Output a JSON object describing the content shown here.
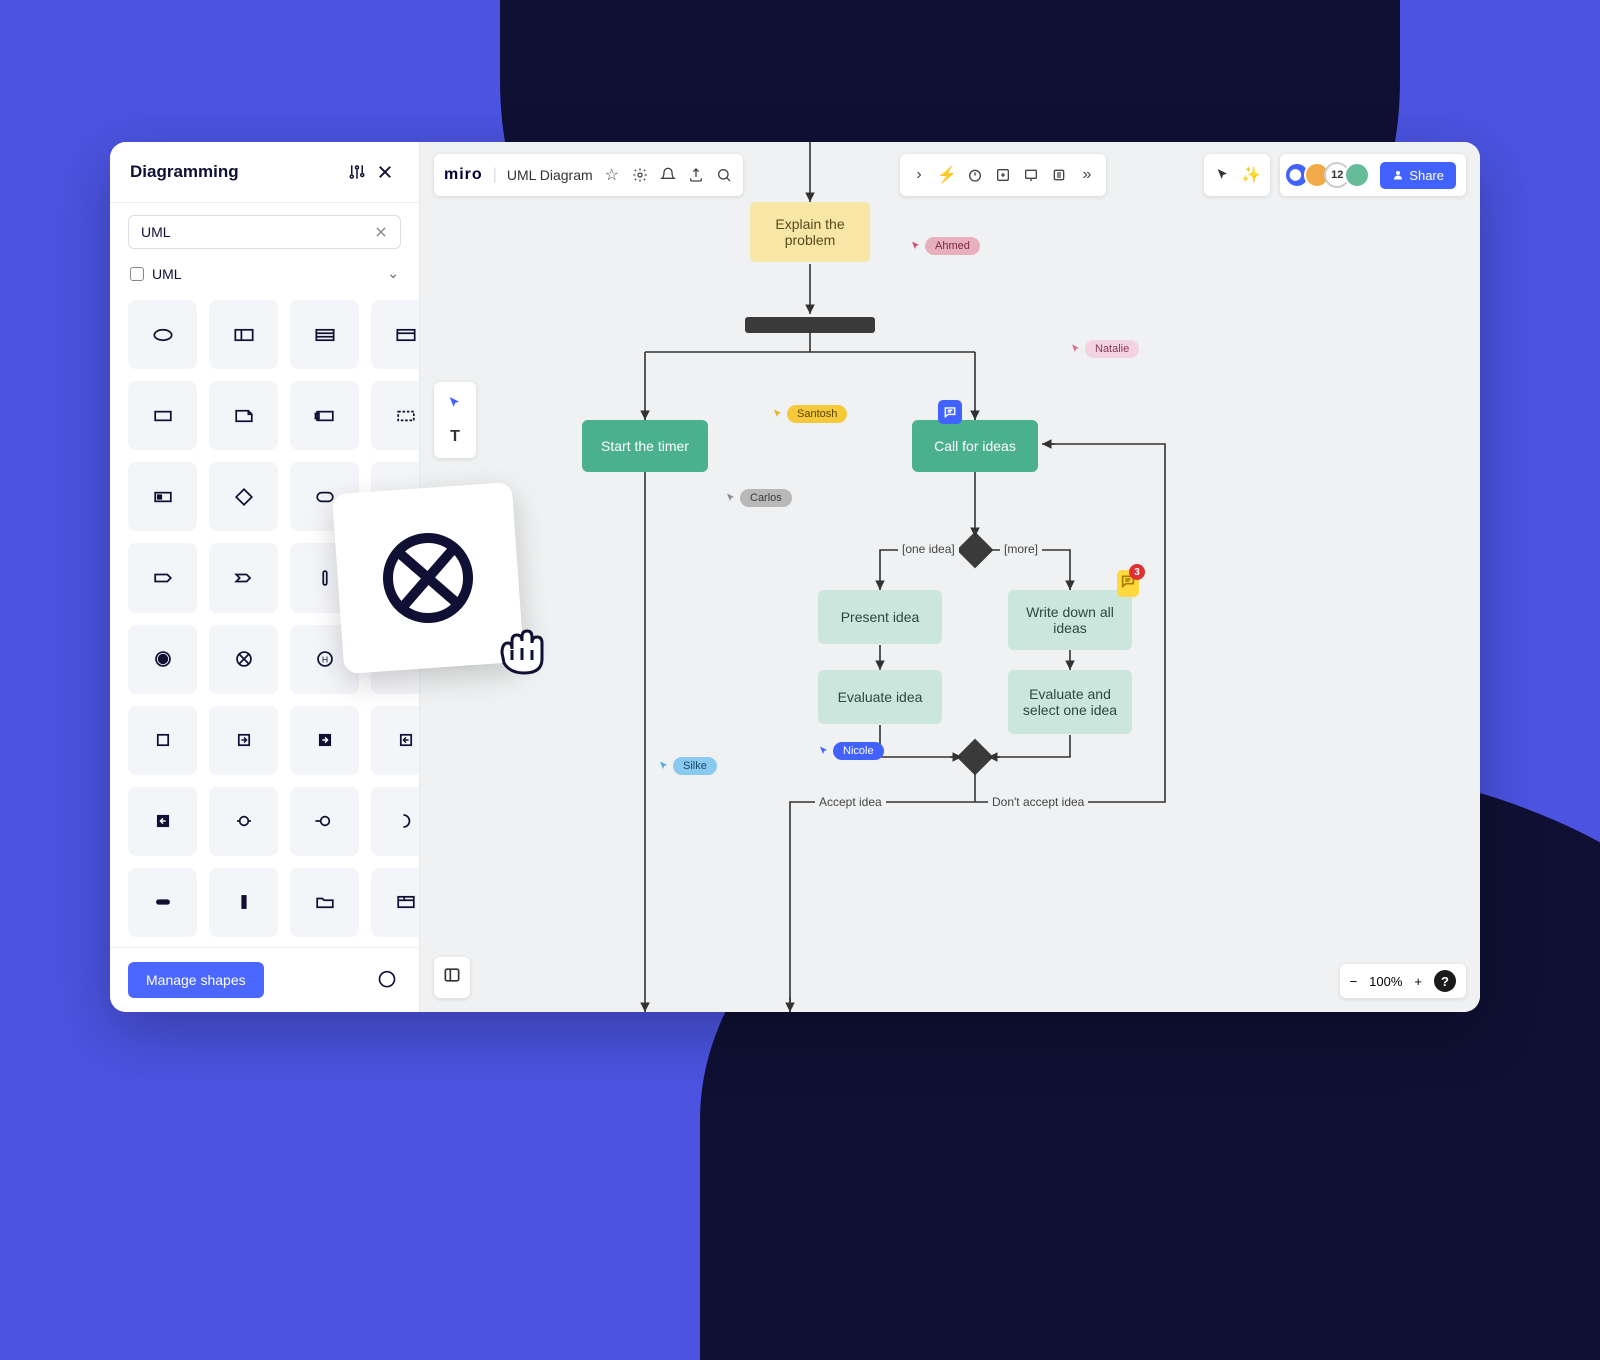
{
  "sidebar": {
    "title": "Diagramming",
    "search_value": "UML",
    "category_label": "UML",
    "manage_label": "Manage shapes"
  },
  "toolbar": {
    "logo": "miro",
    "board_title": "UML Diagram"
  },
  "collab": {
    "count": "12",
    "share_label": "Share"
  },
  "cursors": {
    "ahmed": "Ahmed",
    "natalie": "Natalie",
    "santosh": "Santosh",
    "carlos": "Carlos",
    "nicole": "Nicole",
    "silke": "Silke"
  },
  "nodes": {
    "explain": "Explain the problem",
    "start_timer": "Start the timer",
    "call_ideas": "Call for ideas",
    "present": "Present idea",
    "writedown": "Write down all ideas",
    "evaluate": "Evaluate idea",
    "eval_select": "Evaluate and select one idea"
  },
  "edges": {
    "one_idea": "[one idea]",
    "more": "[more]",
    "accept": "Accept idea",
    "dont_accept": "Don't accept idea"
  },
  "comment_count": "3",
  "zoom": {
    "level": "100%"
  }
}
